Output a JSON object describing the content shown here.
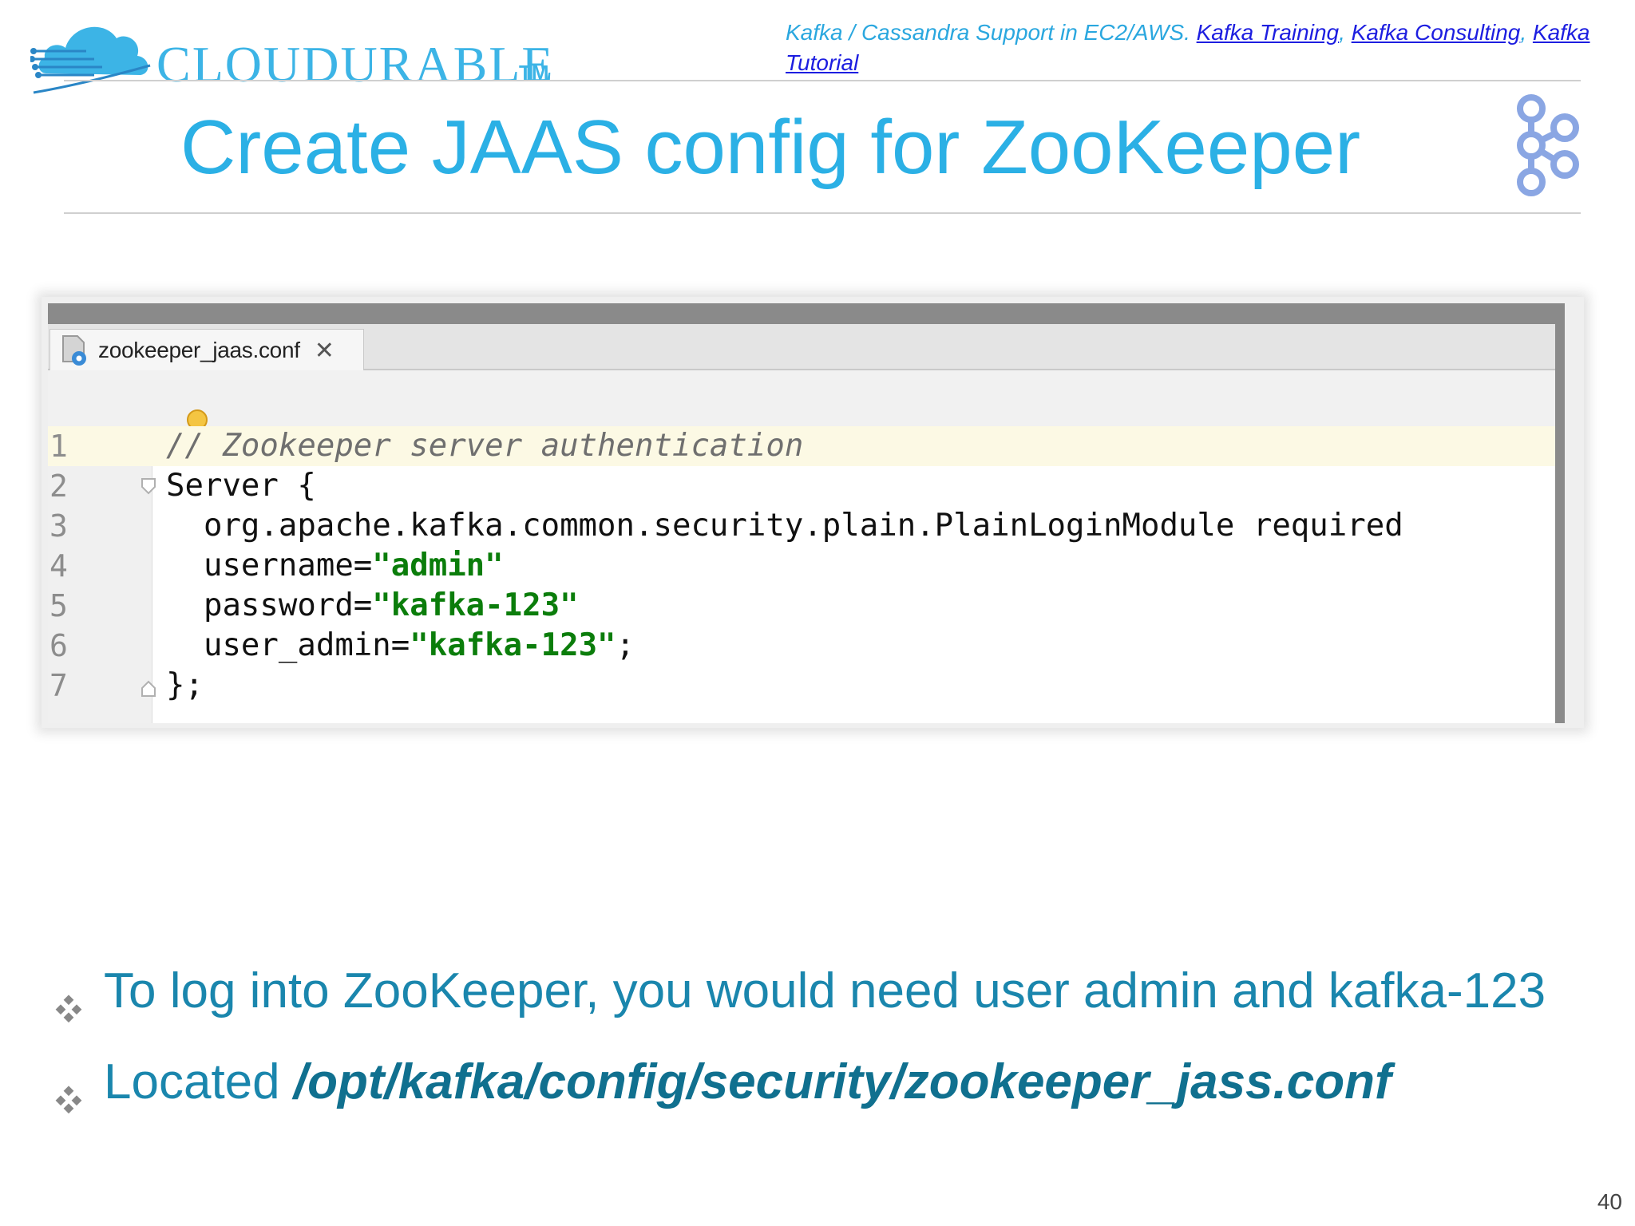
{
  "header": {
    "logo_text": "CLOUDURABLE",
    "logo_tm": "TM",
    "intro": "Kafka / Cassandra Support in EC2/AWS. ",
    "links": [
      "Kafka Training",
      "Kafka Consulting",
      "Kafka Tutorial"
    ],
    "separator": ", "
  },
  "title": "Create JAAS config for ZooKeeper",
  "editor": {
    "tab_label": "zookeeper_jaas.conf",
    "close_glyph": "✕",
    "lines": [
      {
        "num": "1",
        "parts": [
          {
            "t": "// Zookeeper server authentication",
            "c": "cmt"
          }
        ]
      },
      {
        "num": "2",
        "parts": [
          {
            "t": "Server {",
            "c": ""
          }
        ]
      },
      {
        "num": "3",
        "parts": [
          {
            "t": "  org.apache.kafka.common.security.plain.PlainLoginModule required",
            "c": ""
          }
        ]
      },
      {
        "num": "4",
        "parts": [
          {
            "t": "  username=",
            "c": ""
          },
          {
            "t": "\"admin\"",
            "c": "str"
          }
        ]
      },
      {
        "num": "5",
        "parts": [
          {
            "t": "  password=",
            "c": ""
          },
          {
            "t": "\"kafka-123\"",
            "c": "str"
          }
        ]
      },
      {
        "num": "6",
        "parts": [
          {
            "t": "  user_admin=",
            "c": ""
          },
          {
            "t": "\"kafka-123\"",
            "c": "str"
          },
          {
            "t": ";",
            "c": ""
          }
        ]
      },
      {
        "num": "7",
        "parts": [
          {
            "t": "};",
            "c": ""
          }
        ]
      }
    ]
  },
  "bullets": {
    "b1": "To log into ZooKeeper, you would need user admin and kafka-123",
    "b2_prefix": "Located ",
    "b2_path": "/opt/kafka/config/security/zookeeper_jass.conf"
  },
  "page_number": "40",
  "colors": {
    "accent": "#2bb0e5",
    "bullet": "#1a86ad",
    "string": "#0b7d0b",
    "link": "#1d1ee0"
  },
  "icons": [
    "cloud-logo-icon",
    "kafka-icon",
    "config-file-icon",
    "lightbulb-icon",
    "diamond-bullet-icon"
  ]
}
